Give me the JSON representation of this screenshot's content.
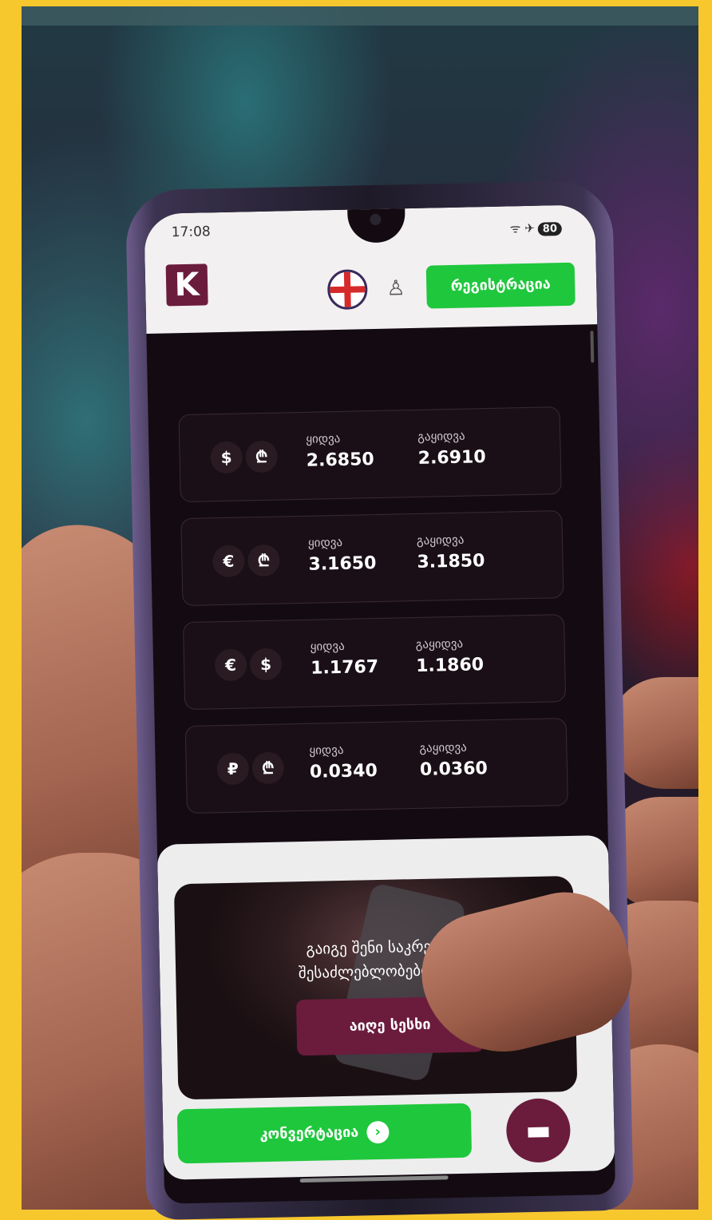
{
  "status_bar": {
    "time": "17:08",
    "battery": "80",
    "signal": "ᯤ ✈"
  },
  "header": {
    "logo": "K",
    "register_label": "რეგისტრაცია"
  },
  "rates": [
    {
      "from": "$",
      "to": "₾",
      "buy_label": "ყიდვა",
      "buy": "2.6850",
      "sell_label": "გაყიდვა",
      "sell": "2.6910"
    },
    {
      "from": "€",
      "to": "₾",
      "buy_label": "ყიდვა",
      "buy": "3.1650",
      "sell_label": "გაყიდვა",
      "sell": "3.1850"
    },
    {
      "from": "€",
      "to": "$",
      "buy_label": "ყიდვა",
      "buy": "1.1767",
      "sell_label": "გაყიდვა",
      "sell": "1.1860"
    },
    {
      "from": "₽",
      "to": "₾",
      "buy_label": "ყიდვა",
      "buy": "0.0340",
      "sell_label": "გაყიდვა",
      "sell": "0.0360"
    }
  ],
  "promo": {
    "line1": "გაიგე შენი საკრედ",
    "line2": "შესაძლებლობები Ku",
    "button": "აიღე სესხი"
  },
  "bottom": {
    "convert_label": "კონვერტაცია",
    "convert_arrow": "›",
    "chat_icon": "▬"
  },
  "colors": {
    "accent_green": "#1fc73c",
    "brand": "#6b1c3c"
  }
}
